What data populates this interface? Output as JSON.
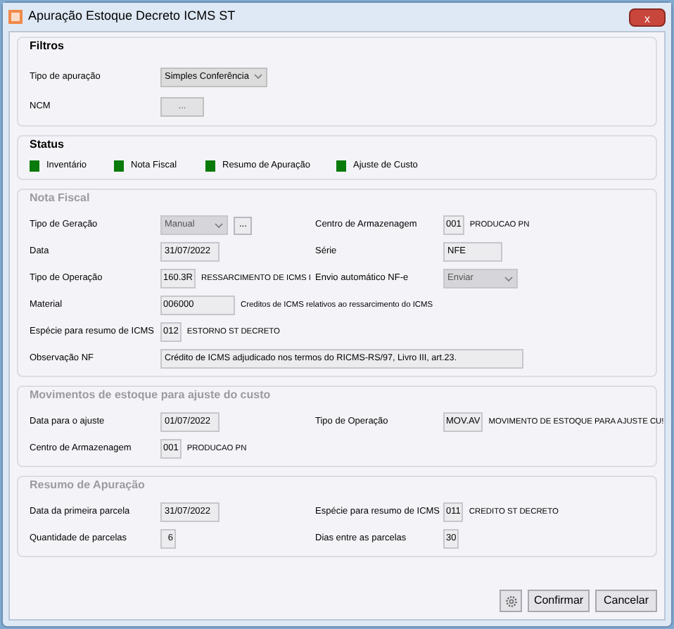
{
  "window": {
    "title": "Apuração Estoque Decreto ICMS ST",
    "close": "x"
  },
  "filtros": {
    "title": "Filtros",
    "disabled": false,
    "rows": [
      {
        "left": {
          "label": "Tipo de apuração",
          "kind": "select",
          "value": "Simples Conferência"
        }
      },
      {
        "left": {
          "label": "NCM",
          "kind": "button",
          "value": "..."
        }
      }
    ]
  },
  "status": {
    "title": "Status",
    "items": [
      {
        "label": "Inventário",
        "color": "#0a7a0a"
      },
      {
        "label": "Nota Fiscal",
        "color": "#0a7a0a"
      },
      {
        "label": "Resumo de Apuração",
        "color": "#0a7a0a"
      },
      {
        "label": "Ajuste de Custo",
        "color": "#0a7a0a"
      }
    ]
  },
  "sections": [
    {
      "title": "Nota Fiscal",
      "disabled": true,
      "rows": [
        {
          "left": {
            "label": "Tipo de Geração",
            "kind": "select_button",
            "value": "Manual",
            "button": "..."
          },
          "right": {
            "label": "Centro de Armazenagem",
            "kind": "code",
            "value": "001",
            "description": "PRODUCAO PN"
          }
        },
        {
          "left": {
            "label": "Data",
            "kind": "text",
            "value": "31/07/2022"
          },
          "right": {
            "label": "Série",
            "kind": "text",
            "value": "NFE"
          }
        },
        {
          "left": {
            "label": "Tipo de Operação",
            "kind": "code",
            "value": "160.3R",
            "description": "RESSARCIMENTO DE ICMS I"
          },
          "right": {
            "label": "Envio automático NF-e",
            "kind": "select",
            "value": "Enviar"
          }
        },
        {
          "left": {
            "label": "Material",
            "kind": "code_wide",
            "value": "006000",
            "description": "Creditos de ICMS relativos ao ressarcimento do ICMS"
          }
        },
        {
          "left": {
            "label": "Espécie para resumo de ICMS",
            "kind": "code",
            "value": "012",
            "description": "ESTORNO ST DECRETO"
          }
        },
        {
          "left": {
            "label": "Observação NF",
            "kind": "long",
            "value": "Crédito de ICMS adjudicado nos termos do RICMS-RS/97, Livro III, art.23."
          }
        }
      ]
    },
    {
      "title": "Movimentos de estoque para ajuste do custo",
      "disabled": true,
      "rows": [
        {
          "left": {
            "label": "Data para o ajuste",
            "kind": "text",
            "value": "01/07/2022"
          },
          "right": {
            "label": "Tipo de Operação",
            "kind": "code",
            "value": "MOV.AV",
            "description": "MOVIMENTO DE ESTOQUE PARA AJUSTE CU!"
          }
        },
        {
          "left": {
            "label": "Centro de Armazenagem",
            "kind": "code",
            "value": "001",
            "description": "PRODUCAO PN"
          }
        }
      ]
    },
    {
      "title": "Resumo de Apuração",
      "disabled": true,
      "rows": [
        {
          "left": {
            "label": "Data da primeira parcela",
            "kind": "text",
            "value": "31/07/2022"
          },
          "right": {
            "label": "Espécie para resumo de ICMS",
            "kind": "code",
            "value": "011",
            "description": "CREDITO ST DECRETO"
          }
        },
        {
          "left": {
            "label": "Quantidade de parcelas",
            "kind": "number",
            "value": "6"
          },
          "right": {
            "label": "Dias entre as parcelas",
            "kind": "number",
            "value": "30"
          }
        }
      ]
    }
  ],
  "buttons": [
    {
      "kind": "settings"
    },
    {
      "kind": "text",
      "label": "Confirmar"
    },
    {
      "kind": "text",
      "label": "Cancelar"
    }
  ]
}
